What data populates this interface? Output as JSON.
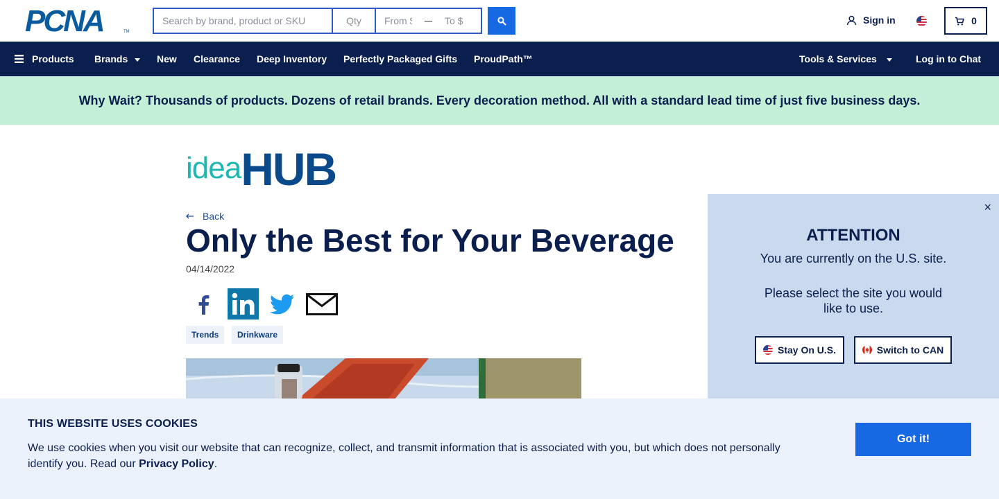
{
  "header": {
    "logo_text": "PCNA",
    "logo_tm": "TM",
    "search_placeholder": "Search by brand, product or SKU",
    "qty_placeholder": "Qty",
    "price_from_placeholder": "From $",
    "price_to_placeholder": "To $",
    "sign_in_label": "Sign in",
    "cart_count": "0"
  },
  "nav": {
    "products_label": "Products",
    "brands_label": "Brands",
    "new_label": "New",
    "clearance_label": "Clearance",
    "deep_inventory_label": "Deep Inventory",
    "gifts_label": "Perfectly Packaged Gifts",
    "proudpath_label": "ProudPath™",
    "tools_label": "Tools & Services",
    "chat_label": "Log in to Chat"
  },
  "banner": {
    "text": "Why Wait? Thousands of products. Dozens of retail brands. Every decoration method. All with a standard lead time of just five business days."
  },
  "article": {
    "brand_idea": "idea",
    "brand_hub": "HUB",
    "back_label": "Back",
    "title": "Only the Best for Your Beverage",
    "date": "04/14/2022",
    "tags": [
      "Trends",
      "Drinkware"
    ]
  },
  "region_popup": {
    "close_glyph": "×",
    "title": "ATTENTION",
    "message": "You are currently on the U.S. site.",
    "prompt": "Please select the site you would like to use.",
    "stay_label": "Stay On U.S.",
    "switch_label": "Switch to CAN"
  },
  "cookies": {
    "title": "THIS WEBSITE USES COOKIES",
    "text": "We use cookies when you visit our website that can recognize, collect, and transmit information that is associated with you, but which does not personally identify you. Read our ",
    "link_label": "Privacy Policy",
    "text_end": ".",
    "button_label": "Got it!"
  },
  "colors": {
    "navy": "#0b1f4e",
    "accent_blue": "#1668e3",
    "banner_green": "#c3efd6",
    "popup_bg": "#cbd9ee",
    "cookie_bg": "#ebf1fa",
    "teal": "#1fb7b1"
  },
  "icons": [
    "search-icon",
    "user-icon",
    "us-flag-icon",
    "cart-icon",
    "menu-icon",
    "caret-down-icon",
    "back-arrow-icon",
    "facebook-icon",
    "linkedin-icon",
    "twitter-icon",
    "email-icon",
    "close-icon",
    "canada-flag-icon"
  ]
}
